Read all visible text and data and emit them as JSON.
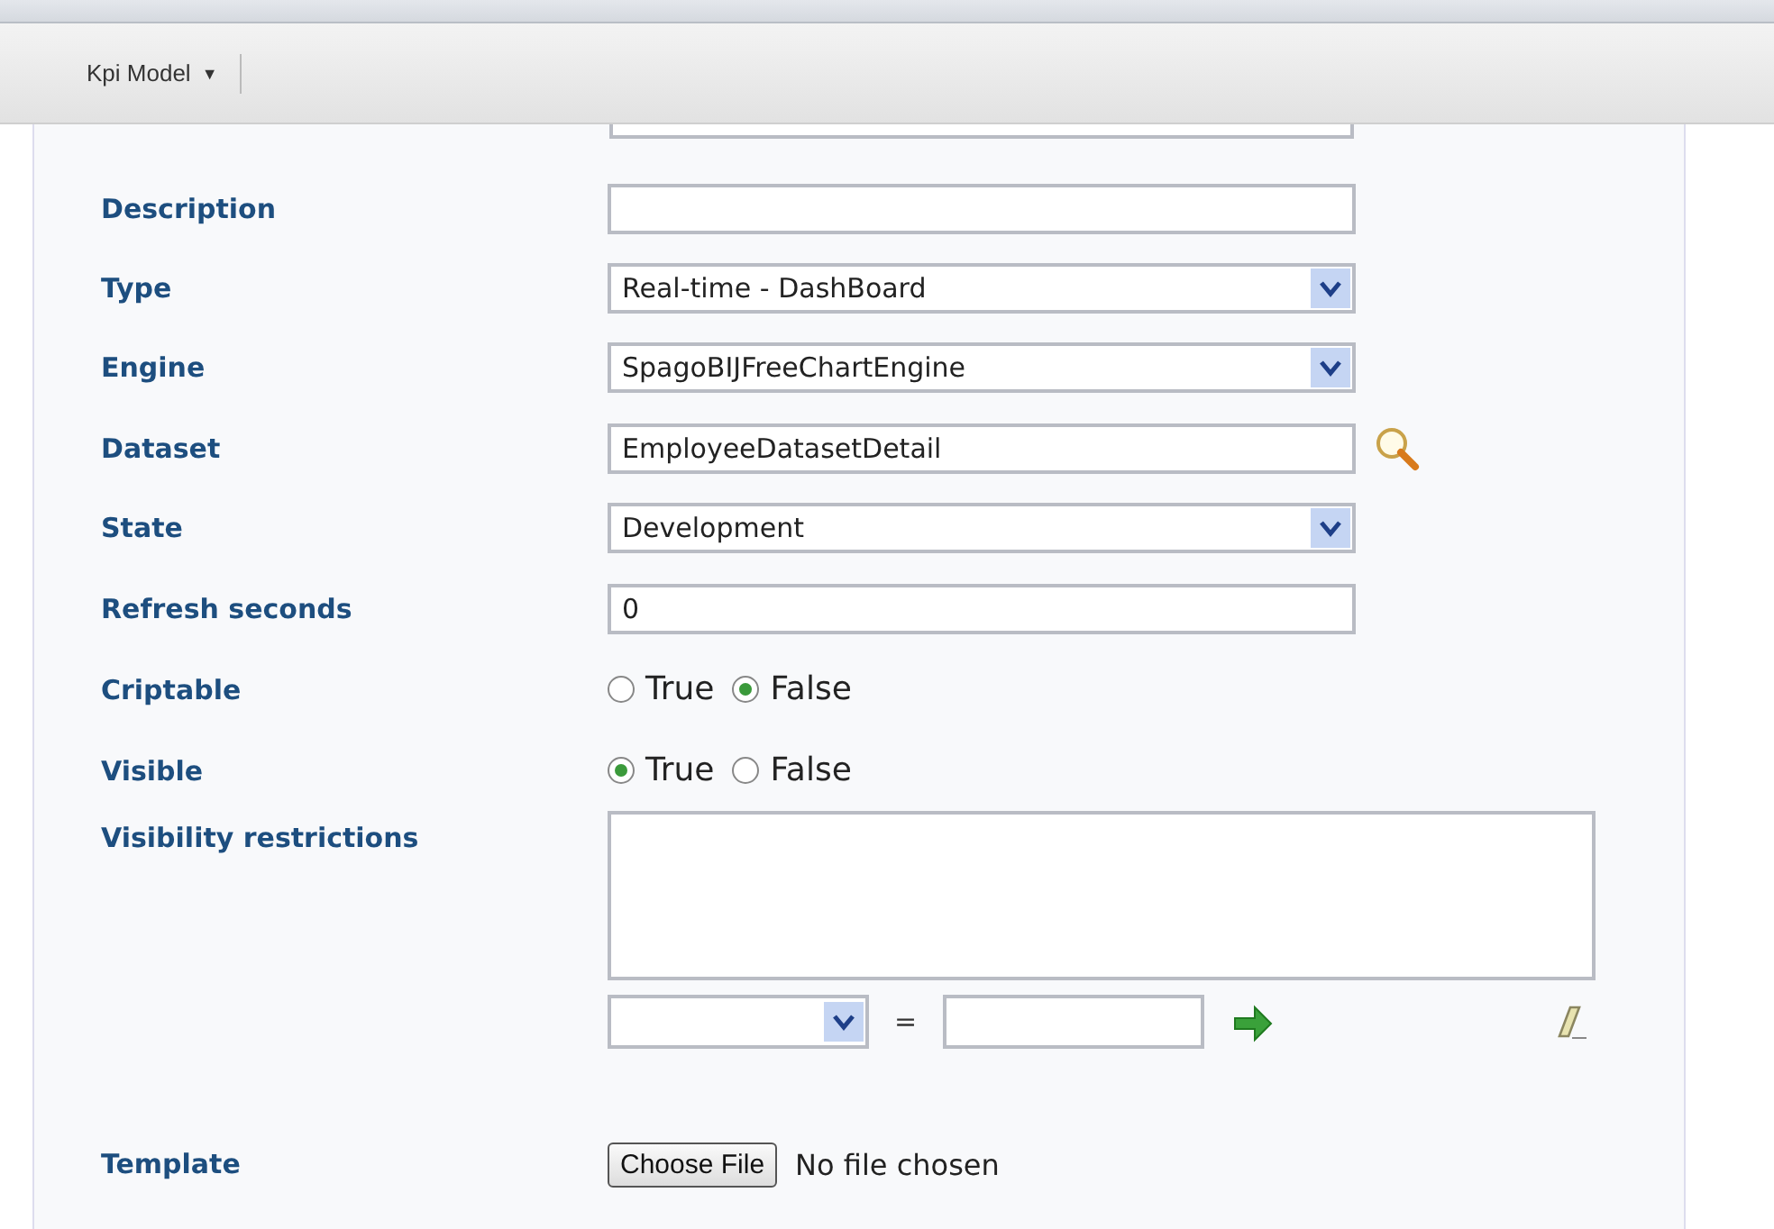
{
  "toolbar": {
    "menu": {
      "label": "Kpi Model",
      "caret": "▼"
    }
  },
  "form": {
    "fields": [
      {
        "kind": "text",
        "label": "Description"
      },
      {
        "kind": "select",
        "label": "Type",
        "value": "Real-time - DashBoard"
      },
      {
        "kind": "select",
        "label": "Engine",
        "value": "SpagoBIJFreeChartEngine"
      },
      {
        "kind": "lookup",
        "label": "Dataset",
        "value": "EmployeeDatasetDetail"
      },
      {
        "kind": "select",
        "label": "State",
        "value": "Development"
      },
      {
        "kind": "text",
        "label": "Refresh seconds",
        "value": "0"
      },
      {
        "kind": "radio",
        "label": "Criptable",
        "options": [
          {
            "label": "True",
            "selected": false
          },
          {
            "label": "False",
            "selected": true
          }
        ]
      },
      {
        "kind": "radio",
        "label": "Visible",
        "options": [
          {
            "label": "True",
            "selected": true
          },
          {
            "label": "False",
            "selected": false
          }
        ]
      },
      {
        "kind": "restrictions",
        "label": "Visibility restrictions",
        "operator": "="
      },
      {
        "kind": "file",
        "label": "Template",
        "button": "Choose File",
        "status": "No file chosen"
      }
    ]
  }
}
